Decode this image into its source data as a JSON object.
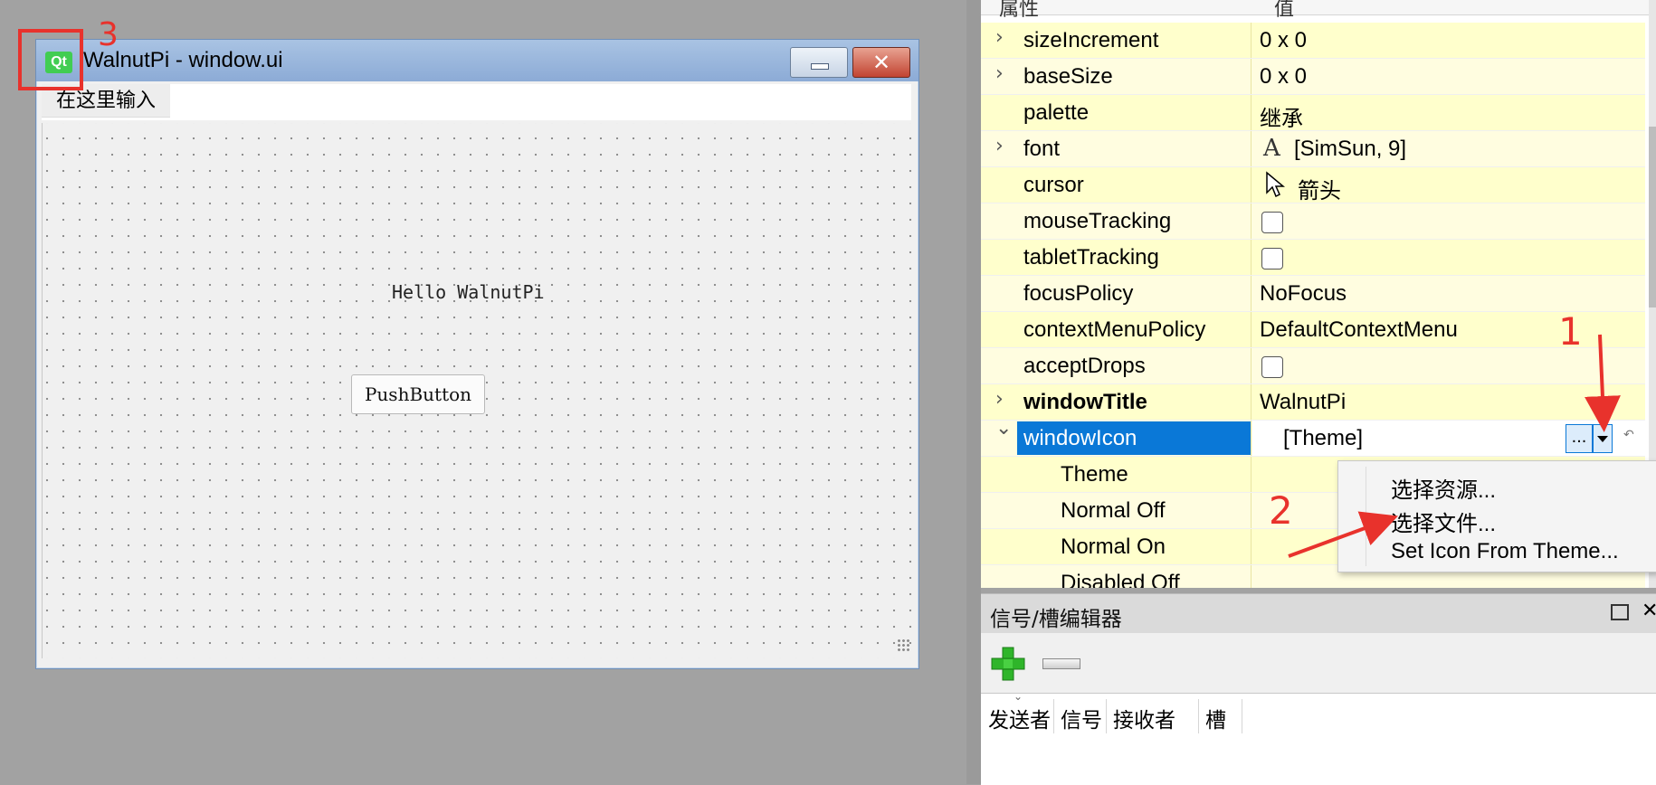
{
  "designer": {
    "logo_text": "Qt",
    "window_title": "WalnutPi - window.ui",
    "minimize_icon": "minimize-icon",
    "close_icon": "close-icon",
    "close_glyph": "✕",
    "menu_placeholder": "在这里输入",
    "label_text": "Hello WalnutPi",
    "button_text": "PushButton"
  },
  "property_editor": {
    "header_property": "属性",
    "header_value": "值",
    "rows": [
      {
        "name": "sizeIncrement",
        "value": "0 x 0",
        "expandable": true
      },
      {
        "name": "baseSize",
        "value": "0 x 0",
        "expandable": true
      },
      {
        "name": "palette",
        "value": "继承",
        "expandable": false
      },
      {
        "name": "font",
        "value": "[SimSun, 9]",
        "expandable": true,
        "icon": "font-icon",
        "icon_glyph": "A"
      },
      {
        "name": "cursor",
        "value": "箭头",
        "expandable": false,
        "icon": "cursor-arrow-icon"
      },
      {
        "name": "mouseTracking",
        "value": "",
        "checkbox": true,
        "checked": false
      },
      {
        "name": "tabletTracking",
        "value": "",
        "checkbox": true,
        "checked": false
      },
      {
        "name": "focusPolicy",
        "value": "NoFocus"
      },
      {
        "name": "contextMenuPolicy",
        "value": "DefaultContextMenu"
      },
      {
        "name": "acceptDrops",
        "value": "",
        "checkbox": true,
        "checked": false
      },
      {
        "name": "windowTitle",
        "value": "WalnutPi",
        "expandable": true,
        "bold": true
      },
      {
        "name": "windowIcon",
        "value": "[Theme]",
        "expanded": true,
        "selected": true,
        "dots": "..."
      },
      {
        "name": "Theme",
        "value": "",
        "sub": true
      },
      {
        "name": "Normal Off",
        "value": "",
        "sub": true
      },
      {
        "name": "Normal On",
        "value": "",
        "sub": true
      },
      {
        "name": "Disabled Off",
        "value": "",
        "sub": true
      }
    ],
    "context_menu": [
      "选择资源...",
      "选择文件...",
      "Set Icon From Theme..."
    ]
  },
  "annotations": {
    "one": "1",
    "two": "2",
    "three": "3"
  },
  "signal_slot_editor": {
    "title": "信号/槽编辑器",
    "columns": [
      "发送者",
      "信号",
      "接收者",
      "槽"
    ],
    "add_icon": "add-icon",
    "remove_icon": "remove-icon",
    "float_icon": "float-icon",
    "close_icon": "close-icon",
    "close_glyph": "✕",
    "sort_glyph": "⌄"
  },
  "colors": {
    "row_bg": "#ffffcc",
    "row_bg_alt": "#fffde0",
    "selection": "#0a78d7",
    "annotation_red": "#e8322c",
    "qt_green": "#41cd52"
  }
}
